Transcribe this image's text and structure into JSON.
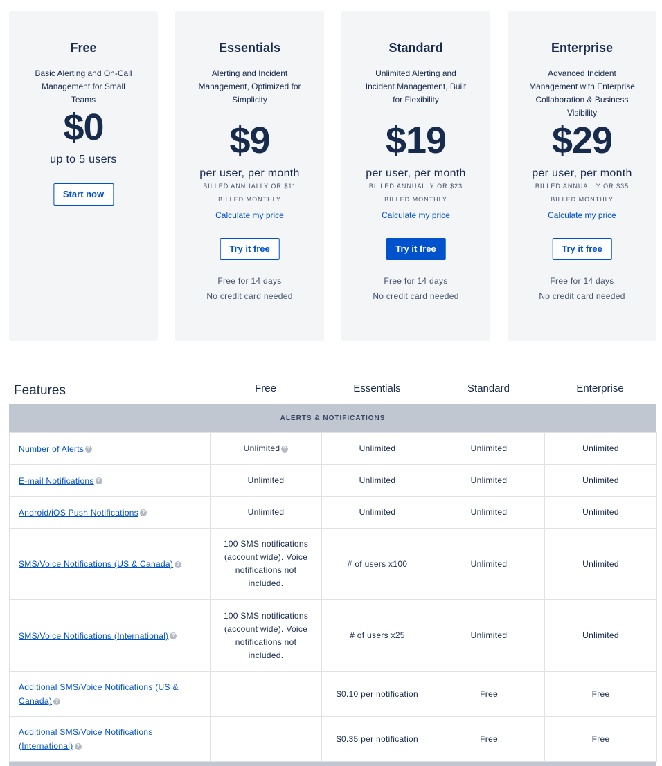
{
  "plans": [
    {
      "name": "Free",
      "description": "Basic Alerting and On-Call Management for Small Teams",
      "price": "$0",
      "subtitle": "up to 5 users",
      "button": "Start now"
    },
    {
      "name": "Essentials",
      "description": "Alerting and Incident Management, Optimized for Simplicity",
      "price": "$9",
      "subtitle": "per user, per month",
      "billed": "BILLED ANNUALLY OR $11 BILLED MONTHLY",
      "calculate": "Calculate my price",
      "button": "Try it free",
      "note1": "Free for 14 days",
      "note2": "No credit card needed"
    },
    {
      "name": "Standard",
      "description": "Unlimited Alerting and Incident Management, Built for Flexibility",
      "price": "$19",
      "subtitle": "per user, per month",
      "billed": "BILLED ANNUALLY OR $23 BILLED MONTHLY",
      "calculate": "Calculate my price",
      "button": "Try it free",
      "note1": "Free for 14 days",
      "note2": "No credit card needed"
    },
    {
      "name": "Enterprise",
      "description": "Advanced Incident Management with Enterprise Collaboration & Business Visibility",
      "price": "$29",
      "subtitle": "per user, per month",
      "billed": "BILLED ANNUALLY OR $35 BILLED MONTHLY",
      "calculate": "Calculate my price",
      "button": "Try it free",
      "note1": "Free for 14 days",
      "note2": "No credit card needed"
    }
  ],
  "features": {
    "title": "Features",
    "columns": [
      "Free",
      "Essentials",
      "Standard",
      "Enterprise"
    ],
    "section": "ALERTS & NOTIFICATIONS",
    "help_icon": "?",
    "rows": [
      {
        "name": "Number of Alerts",
        "values": [
          "Unlimited",
          "Unlimited",
          "Unlimited",
          "Unlimited"
        ]
      },
      {
        "name": "E-mail Notifications",
        "values": [
          "Unlimited",
          "Unlimited",
          "Unlimited",
          "Unlimited"
        ]
      },
      {
        "name": "Android/iOS Push Notifications",
        "values": [
          "Unlimited",
          "Unlimited",
          "Unlimited",
          "Unlimited"
        ]
      },
      {
        "name": "SMS/Voice Notifications (US & Canada)",
        "values": [
          "100 SMS notifications (account wide). Voice notifications not included.",
          "# of users x100",
          "Unlimited",
          "Unlimited"
        ]
      },
      {
        "name": "SMS/Voice Notifications (International)",
        "values": [
          "100 SMS notifications (account wide). Voice notifications not included.",
          "# of users x25",
          "Unlimited",
          "Unlimited"
        ]
      },
      {
        "name": "Additional SMS/Voice Notifications (US & Canada)",
        "values": [
          "",
          "$0.10 per notification",
          "Free",
          "Free"
        ]
      },
      {
        "name": "Additional SMS/Voice Notifications (International)",
        "values": [
          "",
          "$0.35 per notification",
          "Free",
          "Free"
        ]
      }
    ]
  },
  "colors": {
    "accent": "#0052cc",
    "text": "#172b4d",
    "card_bg": "#f4f5f7",
    "section_bg": "#c1c7d0"
  }
}
